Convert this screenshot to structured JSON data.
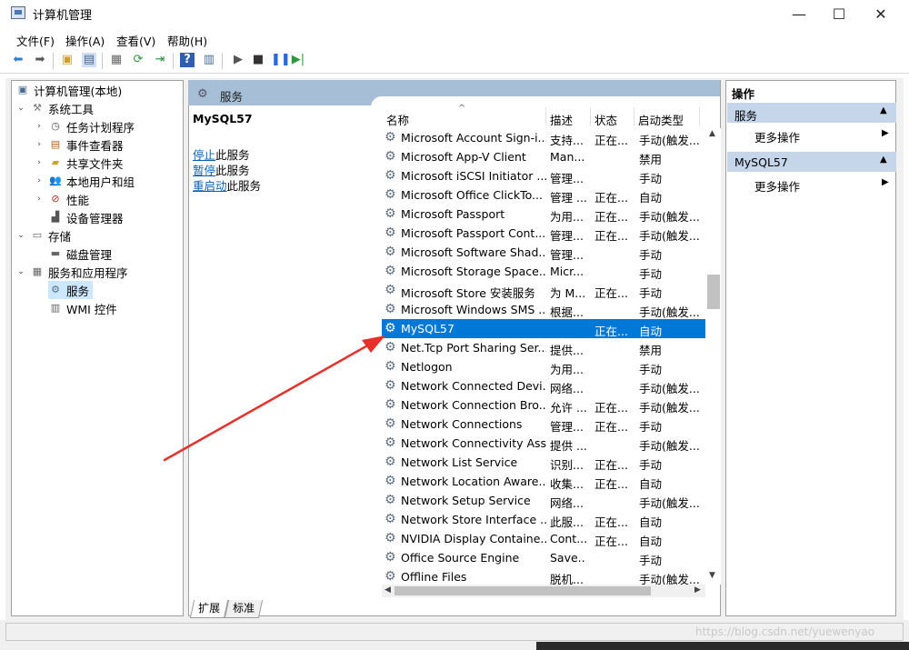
{
  "window": {
    "title": "计算机管理",
    "minimize": "—",
    "maximize": "☐",
    "close": "✕"
  },
  "menu": [
    "文件(F)",
    "操作(A)",
    "查看(V)",
    "帮助(H)"
  ],
  "tree": {
    "root": "计算机管理(本地)",
    "system_tools": "系统工具",
    "task_scheduler": "任务计划程序",
    "event_viewer": "事件查看器",
    "shared_folders": "共享文件夹",
    "local_users": "本地用户和组",
    "performance": "性能",
    "device_manager": "设备管理器",
    "storage": "存储",
    "disk_management": "磁盘管理",
    "services_apps": "服务和应用程序",
    "services": "服务",
    "wmi": "WMI 控件"
  },
  "center": {
    "header_title": "服务",
    "selected_service": "MySQL57",
    "actions": [
      {
        "link": "停止",
        "rest": "此服务"
      },
      {
        "link": "暂停",
        "rest": "此服务"
      },
      {
        "link": "重启动",
        "rest": "此服务"
      }
    ]
  },
  "columns": {
    "name": "名称",
    "desc": "描述",
    "status": "状态",
    "startup": "启动类型"
  },
  "services": [
    {
      "name": "Microsoft Account Sign-i...",
      "desc": "支持...",
      "status": "正在...",
      "startup": "手动(触发..."
    },
    {
      "name": "Microsoft App-V Client",
      "desc": "Man...",
      "status": "",
      "startup": "禁用"
    },
    {
      "name": "Microsoft iSCSI Initiator ...",
      "desc": "管理...",
      "status": "",
      "startup": "手动"
    },
    {
      "name": "Microsoft Office ClickTo...",
      "desc": "管理 ...",
      "status": "正在...",
      "startup": "自动"
    },
    {
      "name": "Microsoft Passport",
      "desc": "为用...",
      "status": "正在...",
      "startup": "手动(触发..."
    },
    {
      "name": "Microsoft Passport Cont...",
      "desc": "管理...",
      "status": "正在...",
      "startup": "手动(触发..."
    },
    {
      "name": "Microsoft Software Shad...",
      "desc": "管理...",
      "status": "",
      "startup": "手动"
    },
    {
      "name": "Microsoft Storage Space...",
      "desc": "Micr...",
      "status": "",
      "startup": "手动"
    },
    {
      "name": "Microsoft Store 安装服务",
      "desc": "为 M...",
      "status": "正在...",
      "startup": "手动"
    },
    {
      "name": "Microsoft Windows SMS ...",
      "desc": "根据...",
      "status": "",
      "startup": "手动(触发..."
    },
    {
      "name": "MySQL57",
      "desc": "",
      "status": "正在...",
      "startup": "自动"
    },
    {
      "name": "Net.Tcp Port Sharing Ser...",
      "desc": "提供...",
      "status": "",
      "startup": "禁用"
    },
    {
      "name": "Netlogon",
      "desc": "为用...",
      "status": "",
      "startup": "手动"
    },
    {
      "name": "Network Connected Devi...",
      "desc": "网络...",
      "status": "",
      "startup": "手动(触发..."
    },
    {
      "name": "Network Connection Bro...",
      "desc": "允许 ...",
      "status": "正在...",
      "startup": "手动(触发..."
    },
    {
      "name": "Network Connections",
      "desc": "管理...",
      "status": "正在...",
      "startup": "手动"
    },
    {
      "name": "Network Connectivity Ass...",
      "desc": "提供 ...",
      "status": "",
      "startup": "手动(触发..."
    },
    {
      "name": "Network List Service",
      "desc": "识别...",
      "status": "正在...",
      "startup": "手动"
    },
    {
      "name": "Network Location Aware...",
      "desc": "收集...",
      "status": "正在...",
      "startup": "自动"
    },
    {
      "name": "Network Setup Service",
      "desc": "网络...",
      "status": "",
      "startup": "手动(触发..."
    },
    {
      "name": "Network Store Interface ...",
      "desc": "此服...",
      "status": "正在...",
      "startup": "自动"
    },
    {
      "name": "NVIDIA Display Containe...",
      "desc": "Cont...",
      "status": "正在...",
      "startup": "自动"
    },
    {
      "name": "Office  Source Engine",
      "desc": "Save...",
      "status": "",
      "startup": "手动"
    },
    {
      "name": "Offline Files",
      "desc": "脱机...",
      "status": "",
      "startup": "手动(触发..."
    }
  ],
  "tabs": [
    "扩展",
    "标准"
  ],
  "action_panel": {
    "title": "操作",
    "group1": "服务",
    "group1_item": "更多操作",
    "group2": "MySQL57",
    "group2_item": "更多操作"
  },
  "watermark": "https://blog.csdn.net/yuewenyao",
  "colors": {
    "selection": "#0078d7",
    "panel_header": "#a7bfd6",
    "arrow": "#e8302a"
  }
}
